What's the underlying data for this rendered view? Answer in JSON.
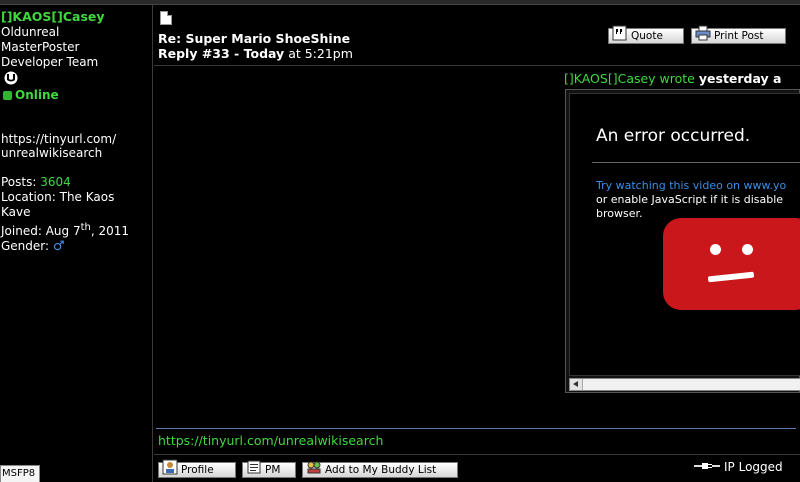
{
  "user": {
    "name": "[]KAOS[]Casey",
    "group_lines": [
      "Oldunreal",
      "MasterPoster",
      "Developer Team"
    ],
    "online_label": "Online",
    "website_lines": [
      "https://tinyurl.com/",
      "unrealwikisearch"
    ],
    "posts_label": "Posts:",
    "posts_value": "3604",
    "location_label": "Location:",
    "location_value_1": "The Kaos",
    "location_value_2": "Kave",
    "joined_label": "Joined:",
    "joined_value": "Aug 7",
    "joined_sup": "th",
    "joined_year": ", 2011",
    "gender_label": "Gender:",
    "gender_symbol": "♂",
    "badge": "MSFP8"
  },
  "post": {
    "title": "Re: Super Mario ShoeShine",
    "reply_prefix": "Reply #33 - ",
    "reply_day": "Today",
    "reply_time": " at 5:21pm",
    "quote_button": "Quote",
    "print_button": "Print Post"
  },
  "quote": {
    "author": "[]KAOS[]Casey wrote",
    "when": "yesterday a",
    "video": {
      "error_title": "An error occurred.",
      "line1_link": "Try watching this video on www.yo",
      "line2": "or enable JavaScript if it is disable",
      "line3": "browser."
    }
  },
  "signature": "https://tinyurl.com/unrealwikisearch",
  "footer": {
    "profile_button": "Profile",
    "pm_button": "PM",
    "buddy_button": "Add to My Buddy List",
    "ip_label": "IP Logged"
  },
  "colors": {
    "username": "#3fd83f",
    "link": "#3a8ee6",
    "error_red": "#c9171b"
  }
}
